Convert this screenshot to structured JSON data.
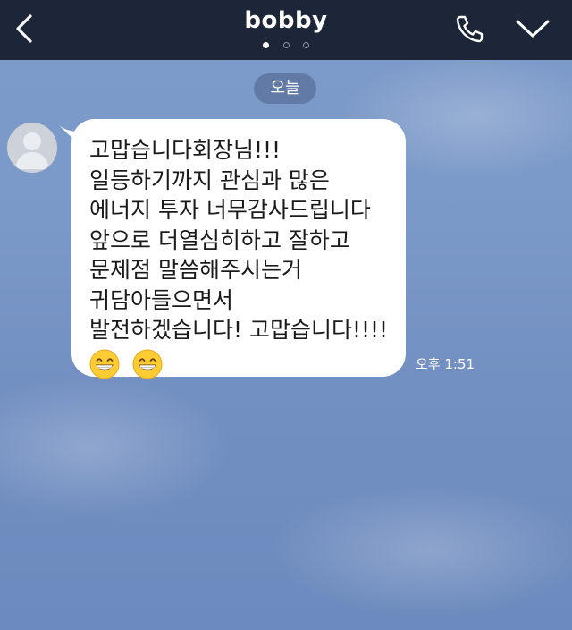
{
  "header": {
    "title": "bobby",
    "page_indicator": {
      "count": 3,
      "active": 1
    }
  },
  "chat": {
    "date_label": "오늘",
    "message": {
      "lines": [
        "고맙습니다회장님!!!",
        "일등하기까지 관심과 많은",
        "에너지 투자 너무감사드립니다",
        "앞으로 더열심히하고 잘하고",
        "문제점 말씀해주시는거",
        "귀담아들으면서",
        "발전하겠습니다! 고맙습니다!!!!"
      ],
      "emojis": [
        "grinning-face-with-smiling-eyes",
        "grinning-face-with-smiling-eyes"
      ],
      "time": "오후 1:51"
    }
  },
  "colors": {
    "header_bg": "#1d2538",
    "chat_bg": "#7c9ac9",
    "bubble_bg": "#ffffff",
    "date_pill_bg": "#4a5f86"
  },
  "icons": {
    "back": "chevron-left-icon",
    "call": "phone-icon",
    "menu": "chevron-down-icon",
    "avatar": "default-avatar-icon"
  }
}
